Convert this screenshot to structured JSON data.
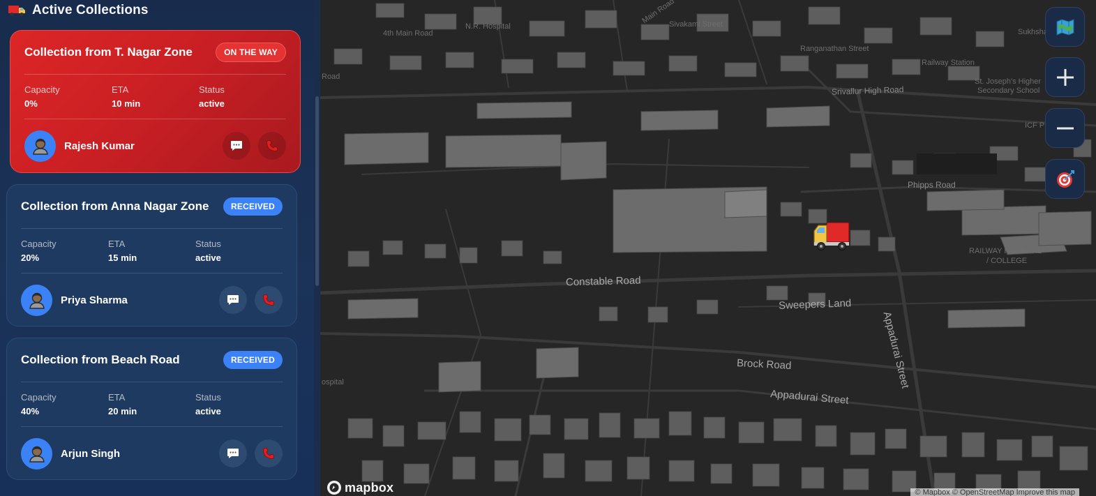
{
  "sidebar": {
    "title": "Active Collections",
    "title_icon": "truck-icon",
    "labels": {
      "capacity": "Capacity",
      "eta": "ETA",
      "status": "Status"
    },
    "collections": [
      {
        "title": "Collection from T. Nagar Zone",
        "badge": "ON THE WAY",
        "capacity": "0%",
        "eta": "10 min",
        "status": "active",
        "driver": "Rajesh Kumar",
        "highlighted": true
      },
      {
        "title": "Collection from Anna Nagar Zone",
        "badge": "RECEIVED",
        "capacity": "20%",
        "eta": "15 min",
        "status": "active",
        "driver": "Priya Sharma",
        "highlighted": false
      },
      {
        "title": "Collection from Beach Road",
        "badge": "RECEIVED",
        "capacity": "40%",
        "eta": "20 min",
        "status": "active",
        "driver": "Arjun Singh",
        "highlighted": false
      }
    ]
  },
  "map": {
    "streets": [
      "Constable Road",
      "Sweepers Land",
      "Brock Road",
      "Appadurai Street",
      "Appadurai Street",
      "Phipps Road",
      "Srivallur High Road"
    ],
    "places": [
      "RAILWAY HOSPITAL",
      "/ COLLEGE",
      "ICF P",
      "Railway Station",
      "St. Joseph's Higher",
      "Secondary School",
      "Sivakami Street",
      "N.R. Hospital",
      "4th Main Road",
      "Ranganathan Street",
      "Main Road",
      "Sukhsha",
      "Road",
      "ospital"
    ],
    "controls": [
      "map-style-icon",
      "zoom-in-icon",
      "zoom-out-icon",
      "locate-icon"
    ],
    "logo_text": "mapbox",
    "attribution": "© Mapbox © OpenStreetMap Improve this map",
    "marker_icon": "truck-icon"
  },
  "colors": {
    "active_card": "#dd2626",
    "badge_received": "#3b82f6",
    "avatar": "#3b82f6",
    "sidebar_bg": "#1b3358",
    "map_bg": "#262626"
  }
}
